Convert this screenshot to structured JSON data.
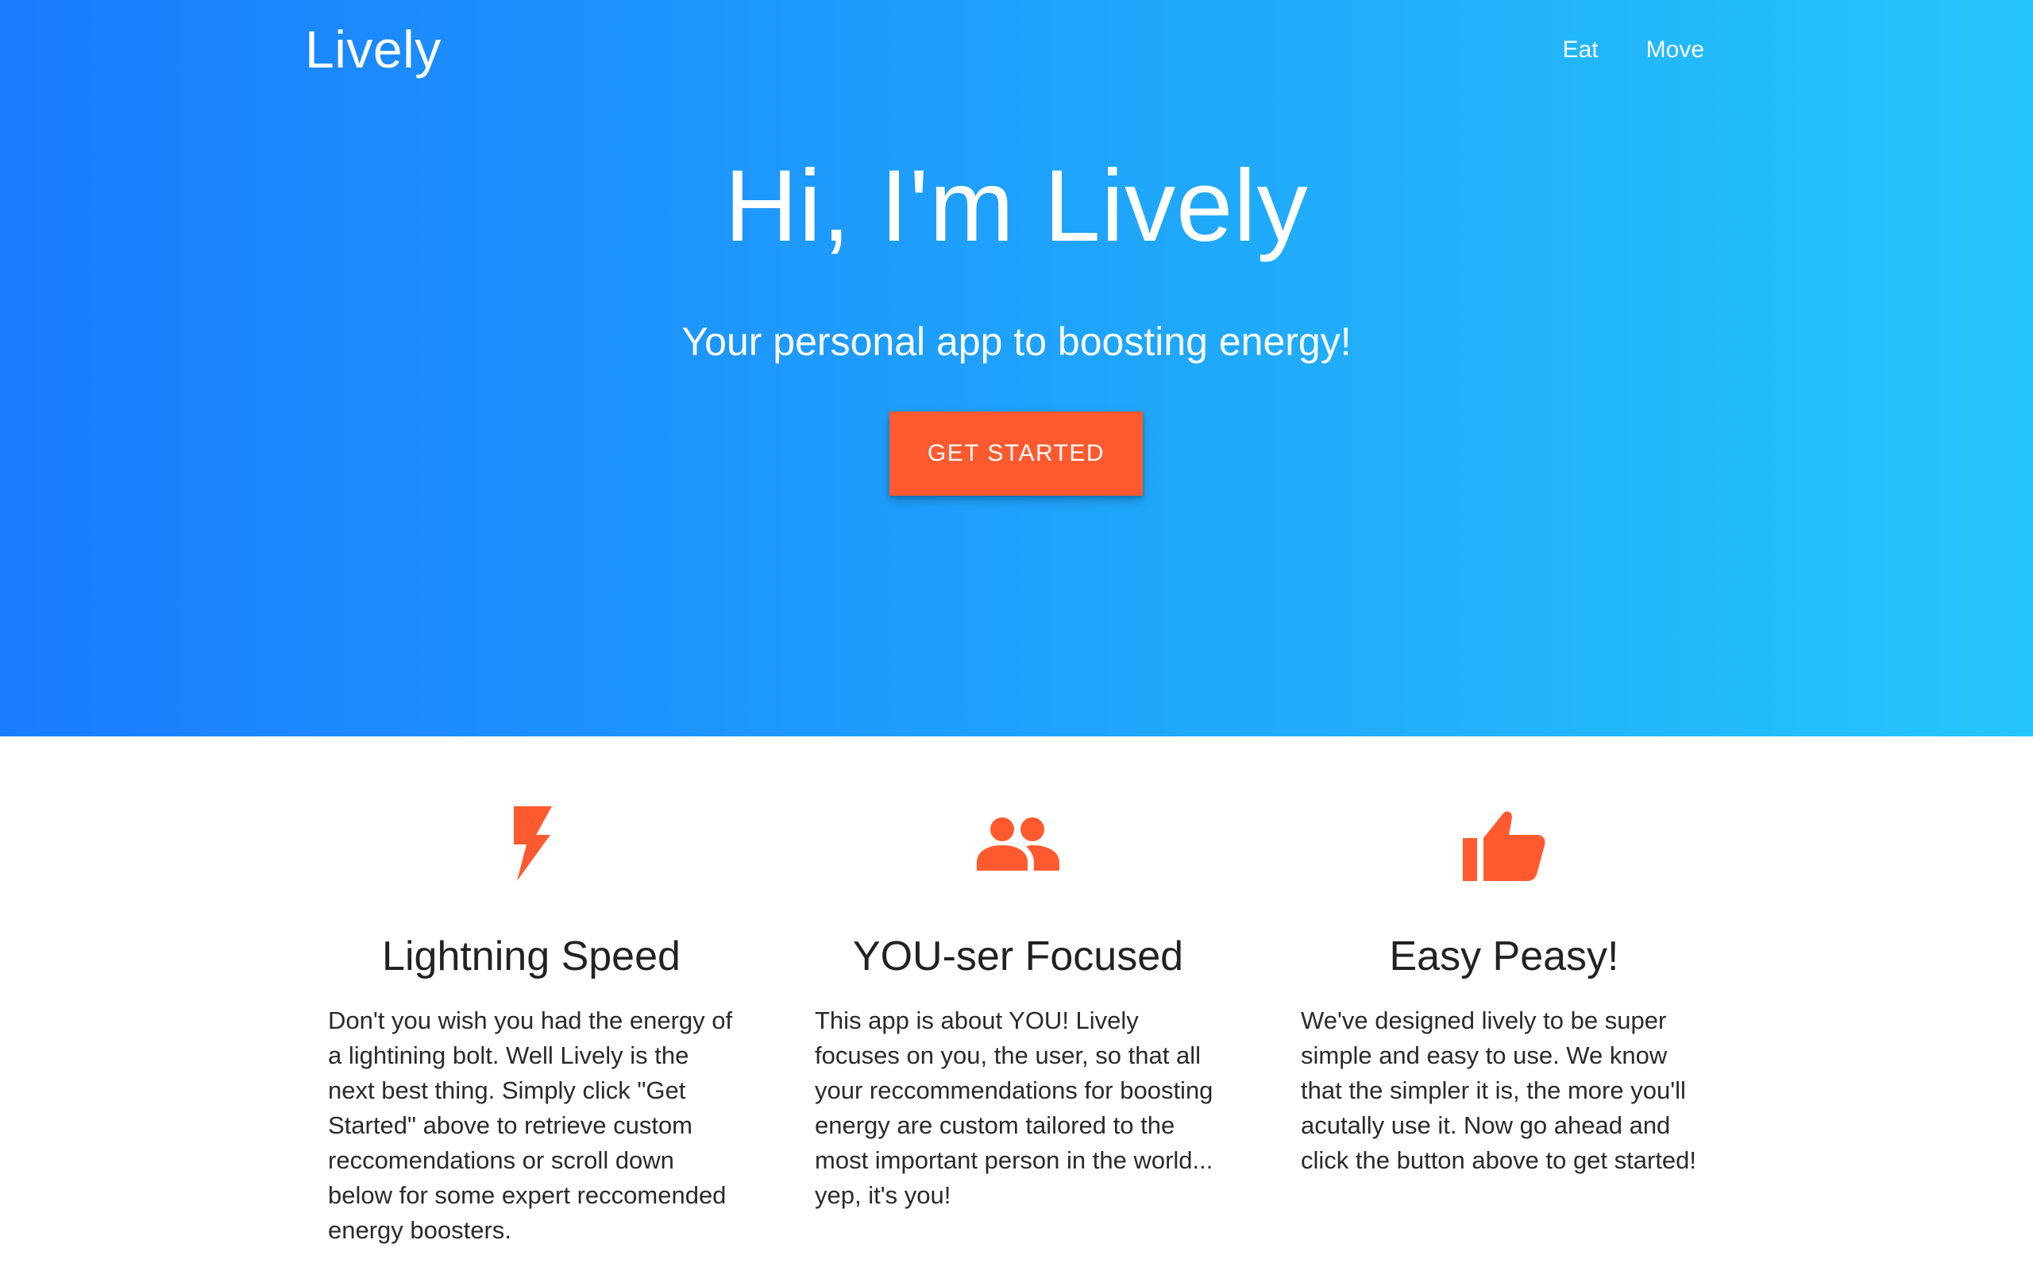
{
  "colors": {
    "hero_gradient_start": "#1a7cff",
    "hero_gradient_end": "#25c6fb",
    "accent": "#ff5a2f",
    "text_dark": "#222222",
    "white": "#ffffff"
  },
  "header": {
    "brand": "Lively",
    "nav": [
      {
        "label": "Eat"
      },
      {
        "label": "Move"
      }
    ]
  },
  "hero": {
    "title": "Hi, I'm Lively",
    "subtitle": "Your personal app to boosting energy!",
    "cta_label": "GET STARTED"
  },
  "features": [
    {
      "icon": "lightning-bolt-icon",
      "title": "Lightning Speed",
      "text": "Don't you wish you had the energy of a lightining bolt. Well Lively is the next best thing. Simply click \"Get Started\" above to retrieve custom reccomendations or scroll down below for some expert reccomended energy boosters."
    },
    {
      "icon": "people-icon",
      "title": "YOU-ser Focused",
      "text": "This app is about YOU! Lively focuses on you, the user, so that all your reccommendations for boosting energy are custom tailored to the most important person in the world... yep, it's you!"
    },
    {
      "icon": "thumbs-up-icon",
      "title": "Easy Peasy!",
      "text": "We've designed lively to be super simple and easy to use. We know that the simpler it is, the more you'll acutally use it. Now go ahead and click the button above to get started!"
    }
  ]
}
